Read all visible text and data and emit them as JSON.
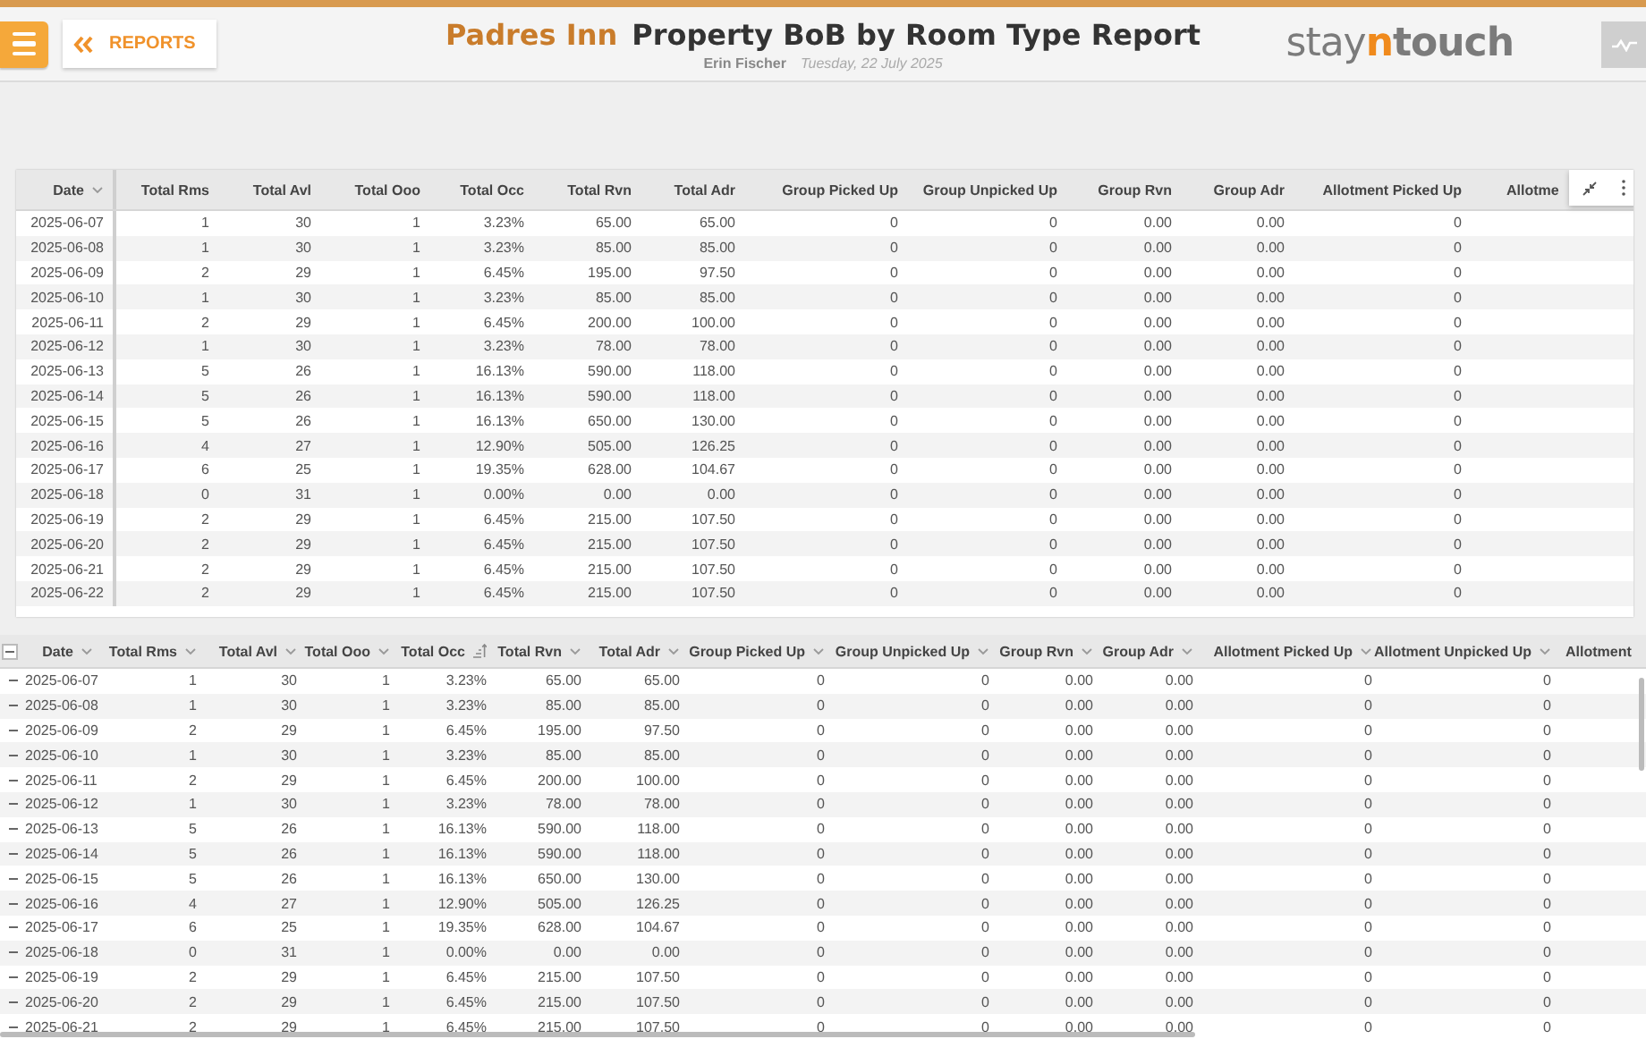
{
  "header": {
    "back_button": {
      "label": "REPORTS"
    },
    "property": "Padres Inn",
    "report_title": "Property BoB by Room Type Report",
    "user": "Erin Fischer",
    "date": "Tuesday, 22 July 2025",
    "logo": {
      "light": "stay",
      "accent": "n",
      "bold": "touch"
    }
  },
  "summary_table": {
    "columns": [
      {
        "label": "Date",
        "menu": true
      },
      {
        "label": "Total Rms",
        "menu": false
      },
      {
        "label": "Total Avl",
        "menu": false
      },
      {
        "label": "Total Ooo",
        "menu": false
      },
      {
        "label": "Total Occ",
        "menu": false
      },
      {
        "label": "Total Rvn",
        "menu": false
      },
      {
        "label": "Total Adr",
        "menu": false
      },
      {
        "label": "Group Picked Up",
        "menu": false
      },
      {
        "label": "Group Unpicked Up",
        "menu": false
      },
      {
        "label": "Group Rvn",
        "menu": false
      },
      {
        "label": "Group Adr",
        "menu": false
      },
      {
        "label": "Allotment Picked Up",
        "menu": false
      },
      {
        "label": "Allotme",
        "menu": false
      }
    ],
    "rows": [
      [
        "2025-06-07",
        "1",
        "30",
        "1",
        "3.23%",
        "65.00",
        "65.00",
        "0",
        "0",
        "0.00",
        "0.00",
        "0"
      ],
      [
        "2025-06-08",
        "1",
        "30",
        "1",
        "3.23%",
        "85.00",
        "85.00",
        "0",
        "0",
        "0.00",
        "0.00",
        "0"
      ],
      [
        "2025-06-09",
        "2",
        "29",
        "1",
        "6.45%",
        "195.00",
        "97.50",
        "0",
        "0",
        "0.00",
        "0.00",
        "0"
      ],
      [
        "2025-06-10",
        "1",
        "30",
        "1",
        "3.23%",
        "85.00",
        "85.00",
        "0",
        "0",
        "0.00",
        "0.00",
        "0"
      ],
      [
        "2025-06-11",
        "2",
        "29",
        "1",
        "6.45%",
        "200.00",
        "100.00",
        "0",
        "0",
        "0.00",
        "0.00",
        "0"
      ],
      [
        "2025-06-12",
        "1",
        "30",
        "1",
        "3.23%",
        "78.00",
        "78.00",
        "0",
        "0",
        "0.00",
        "0.00",
        "0"
      ],
      [
        "2025-06-13",
        "5",
        "26",
        "1",
        "16.13%",
        "590.00",
        "118.00",
        "0",
        "0",
        "0.00",
        "0.00",
        "0"
      ],
      [
        "2025-06-14",
        "5",
        "26",
        "1",
        "16.13%",
        "590.00",
        "118.00",
        "0",
        "0",
        "0.00",
        "0.00",
        "0"
      ],
      [
        "2025-06-15",
        "5",
        "26",
        "1",
        "16.13%",
        "650.00",
        "130.00",
        "0",
        "0",
        "0.00",
        "0.00",
        "0"
      ],
      [
        "2025-06-16",
        "4",
        "27",
        "1",
        "12.90%",
        "505.00",
        "126.25",
        "0",
        "0",
        "0.00",
        "0.00",
        "0"
      ],
      [
        "2025-06-17",
        "6",
        "25",
        "1",
        "19.35%",
        "628.00",
        "104.67",
        "0",
        "0",
        "0.00",
        "0.00",
        "0"
      ],
      [
        "2025-06-18",
        "0",
        "31",
        "1",
        "0.00%",
        "0.00",
        "0.00",
        "0",
        "0",
        "0.00",
        "0.00",
        "0"
      ],
      [
        "2025-06-19",
        "2",
        "29",
        "1",
        "6.45%",
        "215.00",
        "107.50",
        "0",
        "0",
        "0.00",
        "0.00",
        "0"
      ],
      [
        "2025-06-20",
        "2",
        "29",
        "1",
        "6.45%",
        "215.00",
        "107.50",
        "0",
        "0",
        "0.00",
        "0.00",
        "0"
      ],
      [
        "2025-06-21",
        "2",
        "29",
        "1",
        "6.45%",
        "215.00",
        "107.50",
        "0",
        "0",
        "0.00",
        "0.00",
        "0"
      ],
      [
        "2025-06-22",
        "2",
        "29",
        "1",
        "6.45%",
        "215.00",
        "107.50",
        "0",
        "0",
        "0.00",
        "0.00",
        "0"
      ]
    ]
  },
  "detail_table": {
    "all_expanded": true,
    "columns": [
      {
        "label": "Date",
        "sorted": false
      },
      {
        "label": "Total Rms",
        "sorted": false
      },
      {
        "label": "Total Avl",
        "sorted": false
      },
      {
        "label": "Total Ooo",
        "sorted": false
      },
      {
        "label": "Total Occ",
        "sorted": true
      },
      {
        "label": "Total Rvn",
        "sorted": false
      },
      {
        "label": "Total Adr",
        "sorted": false
      },
      {
        "label": "Group Picked Up",
        "sorted": false
      },
      {
        "label": "Group Unpicked Up",
        "sorted": false
      },
      {
        "label": "Group Rvn",
        "sorted": false
      },
      {
        "label": "Group Adr",
        "sorted": false
      },
      {
        "label": "Allotment Picked Up",
        "sorted": false
      },
      {
        "label": "Allotment Unpicked Up",
        "sorted": false
      },
      {
        "label": "Allotment"
      }
    ],
    "rows": [
      {
        "expanded": true,
        "cells": [
          "2025-06-07",
          "1",
          "30",
          "1",
          "3.23%",
          "65.00",
          "65.00",
          "0",
          "0",
          "0.00",
          "0.00",
          "0",
          "0"
        ]
      },
      {
        "expanded": true,
        "cells": [
          "2025-06-08",
          "1",
          "30",
          "1",
          "3.23%",
          "85.00",
          "85.00",
          "0",
          "0",
          "0.00",
          "0.00",
          "0",
          "0"
        ]
      },
      {
        "expanded": true,
        "cells": [
          "2025-06-09",
          "2",
          "29",
          "1",
          "6.45%",
          "195.00",
          "97.50",
          "0",
          "0",
          "0.00",
          "0.00",
          "0",
          "0"
        ]
      },
      {
        "expanded": true,
        "cells": [
          "2025-06-10",
          "1",
          "30",
          "1",
          "3.23%",
          "85.00",
          "85.00",
          "0",
          "0",
          "0.00",
          "0.00",
          "0",
          "0"
        ]
      },
      {
        "expanded": true,
        "cells": [
          "2025-06-11",
          "2",
          "29",
          "1",
          "6.45%",
          "200.00",
          "100.00",
          "0",
          "0",
          "0.00",
          "0.00",
          "0",
          "0"
        ]
      },
      {
        "expanded": true,
        "cells": [
          "2025-06-12",
          "1",
          "30",
          "1",
          "3.23%",
          "78.00",
          "78.00",
          "0",
          "0",
          "0.00",
          "0.00",
          "0",
          "0"
        ]
      },
      {
        "expanded": true,
        "cells": [
          "2025-06-13",
          "5",
          "26",
          "1",
          "16.13%",
          "590.00",
          "118.00",
          "0",
          "0",
          "0.00",
          "0.00",
          "0",
          "0"
        ]
      },
      {
        "expanded": true,
        "cells": [
          "2025-06-14",
          "5",
          "26",
          "1",
          "16.13%",
          "590.00",
          "118.00",
          "0",
          "0",
          "0.00",
          "0.00",
          "0",
          "0"
        ]
      },
      {
        "expanded": true,
        "cells": [
          "2025-06-15",
          "5",
          "26",
          "1",
          "16.13%",
          "650.00",
          "130.00",
          "0",
          "0",
          "0.00",
          "0.00",
          "0",
          "0"
        ]
      },
      {
        "expanded": true,
        "cells": [
          "2025-06-16",
          "4",
          "27",
          "1",
          "12.90%",
          "505.00",
          "126.25",
          "0",
          "0",
          "0.00",
          "0.00",
          "0",
          "0"
        ]
      },
      {
        "expanded": true,
        "cells": [
          "2025-06-17",
          "6",
          "25",
          "1",
          "19.35%",
          "628.00",
          "104.67",
          "0",
          "0",
          "0.00",
          "0.00",
          "0",
          "0"
        ]
      },
      {
        "expanded": true,
        "cells": [
          "2025-06-18",
          "0",
          "31",
          "1",
          "0.00%",
          "0.00",
          "0.00",
          "0",
          "0",
          "0.00",
          "0.00",
          "0",
          "0"
        ]
      },
      {
        "expanded": true,
        "cells": [
          "2025-06-19",
          "2",
          "29",
          "1",
          "6.45%",
          "215.00",
          "107.50",
          "0",
          "0",
          "0.00",
          "0.00",
          "0",
          "0"
        ]
      },
      {
        "expanded": true,
        "cells": [
          "2025-06-20",
          "2",
          "29",
          "1",
          "6.45%",
          "215.00",
          "107.50",
          "0",
          "0",
          "0.00",
          "0.00",
          "0",
          "0"
        ]
      },
      {
        "expanded": true,
        "cells": [
          "2025-06-21",
          "2",
          "29",
          "1",
          "6.45%",
          "215.00",
          "107.50",
          "0",
          "0",
          "0.00",
          "0.00",
          "0",
          "0"
        ]
      }
    ]
  }
}
